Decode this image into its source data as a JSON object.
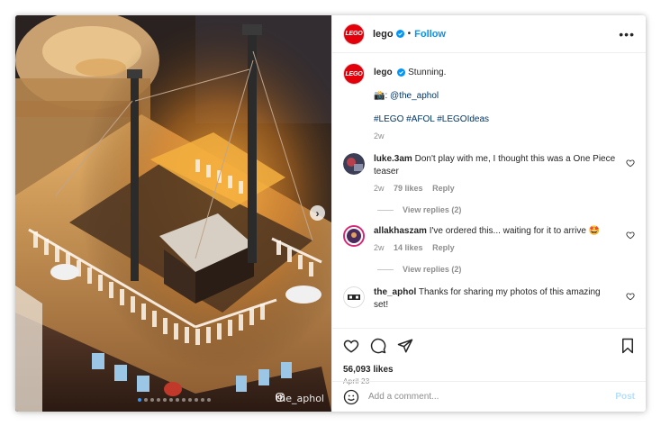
{
  "photo": {
    "alt": "LEGO Titanic model deck detail",
    "carousel_dots": 12,
    "active_dot": 0,
    "watermark": "the_aphol"
  },
  "header": {
    "username": "lego",
    "separator": "•",
    "follow_label": "Follow",
    "more_label": "•••"
  },
  "caption": {
    "username": "lego",
    "text": "Stunning.",
    "photo_credit_emoji": "📸:",
    "photo_credit": "@the_aphol",
    "hashtags": "#LEGO #AFOL #LEGOIdeas",
    "time": "2w"
  },
  "comments": [
    {
      "username": "luke.3am",
      "text": "Don't play with me, I thought this was a One Piece teaser",
      "time": "2w",
      "likes": "79 likes",
      "reply": "Reply",
      "view_replies": "View replies (2)"
    },
    {
      "username": "allakhaszam",
      "text": "I've ordered this... waiting for it to arrive 🤩",
      "time": "2w",
      "likes": "14 likes",
      "reply": "Reply",
      "view_replies": "View replies (2)"
    },
    {
      "username": "the_aphol",
      "text": "Thanks for sharing my photos of this amazing set!"
    }
  ],
  "post": {
    "likes": "56,093 likes",
    "date": "April 23"
  },
  "add_comment": {
    "placeholder": "Add a comment...",
    "post_label": "Post"
  },
  "colors": {
    "accent": "#0095f6",
    "lego_red": "#e3000b",
    "muted": "#8e8e8e"
  }
}
